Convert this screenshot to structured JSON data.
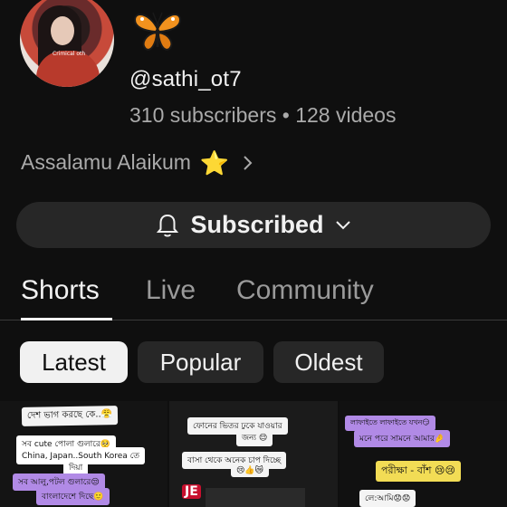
{
  "channel": {
    "handle": "@sathi_ot7",
    "stats": "310 subscribers • 128 videos",
    "bio": "Assalamu Alaikum",
    "bio_emoji": "⭐",
    "avatar_label": "Crimical oth",
    "butterfly_icon": "butterfly-emoji",
    "subscribe_label": "Subscribed"
  },
  "tabs": [
    {
      "label": "Shorts",
      "active": true
    },
    {
      "label": "Live",
      "active": false
    },
    {
      "label": "Community",
      "active": false
    }
  ],
  "filters": [
    {
      "label": "Latest",
      "selected": true
    },
    {
      "label": "Popular",
      "selected": false
    },
    {
      "label": "Oldest",
      "selected": false
    }
  ],
  "thumbnails": [
    {
      "lines": [
        "দেশ ভাগ করছে কে..😤",
        "সব cute পোলা গুলারে🥺",
        "China, Japan..South Korea তে",
        "দিয়া",
        "সব আলু,পটল গুলারে😒",
        "বাংলাদেশে দিছে🙂"
      ]
    },
    {
      "lines": [
        "ফোনের ভিতর ঢুকে যাওয়ার",
        "জন্য 😌",
        "বাসা থেকে অনেক চাপ দিচ্ছে",
        "😢👍😿",
        "JE"
      ]
    },
    {
      "lines": [
        "লাফাইতে লাফাইতে যখন😏",
        "মনে পরে সামনে আমার🤌",
        "পরীক্ষা - বাঁশ 😢😢",
        "লে:আমি😟😟"
      ]
    }
  ],
  "colors": {
    "background": "#0f0f0f",
    "chip_bg": "#272727",
    "chip_selected_bg": "#f1f1f1",
    "text_secondary": "#aaaaaa"
  }
}
